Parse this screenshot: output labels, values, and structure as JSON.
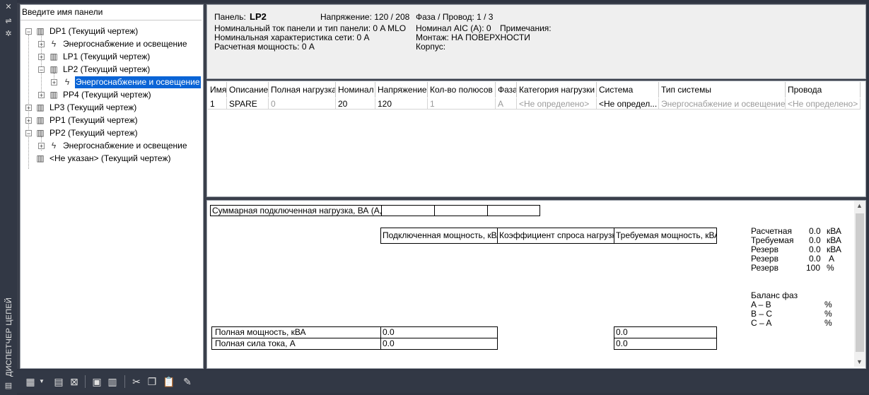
{
  "strip": {
    "title": "ДИСПЕТЧЕР ЦЕПЕЙ",
    "buttons": [
      "✕",
      "⇌",
      "✲"
    ]
  },
  "search": {
    "placeholder": "Введите имя панели"
  },
  "tree": [
    {
      "label": "DP1 (Текущий чертеж)",
      "icon": "panel-icon",
      "expander": "−"
    },
    {
      "label": "Энергоснабжение и освещение",
      "icon": "lightning-icon",
      "expander": "+"
    },
    {
      "label": "LP1 (Текущий чертеж)",
      "icon": "panel-icon",
      "expander": "+"
    },
    {
      "label": "LP2 (Текущий чертеж)",
      "icon": "panel-icon",
      "expander": "−"
    },
    {
      "label": "Энергоснабжение и освещение",
      "icon": "lightning-icon",
      "expander": "+",
      "selected": true
    },
    {
      "label": "PP4 (Текущий чертеж)",
      "icon": "panel-icon",
      "expander": "+"
    },
    {
      "label": "LP3 (Текущий чертеж)",
      "icon": "panel-icon",
      "expander": "+"
    },
    {
      "label": "PP1 (Текущий чертеж)",
      "icon": "panel-icon",
      "expander": "+"
    },
    {
      "label": "PP2 (Текущий чертеж)",
      "icon": "panel-icon",
      "expander": "−"
    },
    {
      "label": "Энергоснабжение и освещение",
      "icon": "lightning-icon",
      "expander": "+"
    },
    {
      "label": "<Не указан> (Текущий чертеж)",
      "icon": "panel-icon",
      "expander": ""
    }
  ],
  "info": {
    "panel_label": "Панель:",
    "panel_value": "LP2",
    "voltage": "Напряжение: 120 / 208",
    "phase_wire": "Фаза / Провод:   1 /  3",
    "rated_current": "Номинальный ток панели и тип панели: 0 A MLO",
    "aic": "Номинал AIC (A):   0",
    "notes": "Примечания:",
    "network": "Номинальная характеристика сети: 0 A",
    "mounting": "Монтаж:   НА ПОВЕРХНОСТИ",
    "design_power": "Расчетная мощность: 0 A",
    "enclosure": "Корпус:"
  },
  "grid": {
    "headers": [
      "Имя",
      "Описание",
      "Полная нагрузка",
      "Номинал",
      "Напряжение",
      "Кол-во полюсов",
      "Фаза",
      "Категория нагрузки",
      "Система",
      "Тип системы",
      "Провода"
    ],
    "row": [
      "1",
      "SPARE",
      "0",
      "20",
      "120",
      "1",
      "A",
      "<Не определено>",
      "<Не определ...",
      "Энергоснабжение и освещение",
      "<Не определено>"
    ]
  },
  "bottom": {
    "sum_label": "Суммарная подключенная нагрузка, ВА (A,B,C)",
    "col_connected": "Подключенная мощность, кВА",
    "col_demand": "Коэффициент спроса нагрузки",
    "col_required": "Требуемая мощность, кВА",
    "total_power_label": "Полная мощность, кВА",
    "total_power_value": "0.0",
    "total_power_req": "0.0",
    "total_current_label": "Полная сила тока, A",
    "total_current_value": "0.0",
    "total_current_req": "0.0"
  },
  "summary": [
    {
      "label": "Расчетная",
      "value": "0.0",
      "unit": "кВА"
    },
    {
      "label": "Требуемая",
      "value": "0.0",
      "unit": "кВА"
    },
    {
      "label": "Резерв",
      "value": "0.0",
      "unit": "кВА"
    },
    {
      "label": "Резерв",
      "value": "0.0",
      "unit": "A"
    },
    {
      "label": "Резерв",
      "value": "100",
      "unit": "%"
    }
  ],
  "balance": {
    "title": "Баланс фаз",
    "rows": [
      {
        "label": "A – B",
        "unit": "%"
      },
      {
        "label": "B – C",
        "unit": "%"
      },
      {
        "label": "C – A",
        "unit": "%"
      }
    ]
  },
  "toolbar": [
    "new-panel-icon",
    "dropdown-icon",
    "new-circuit-icon",
    "delete-icon",
    "copy-panel-icon",
    "paste-panel-icon",
    "cut-icon",
    "copy-icon",
    "paste-icon",
    "edit-icon"
  ]
}
